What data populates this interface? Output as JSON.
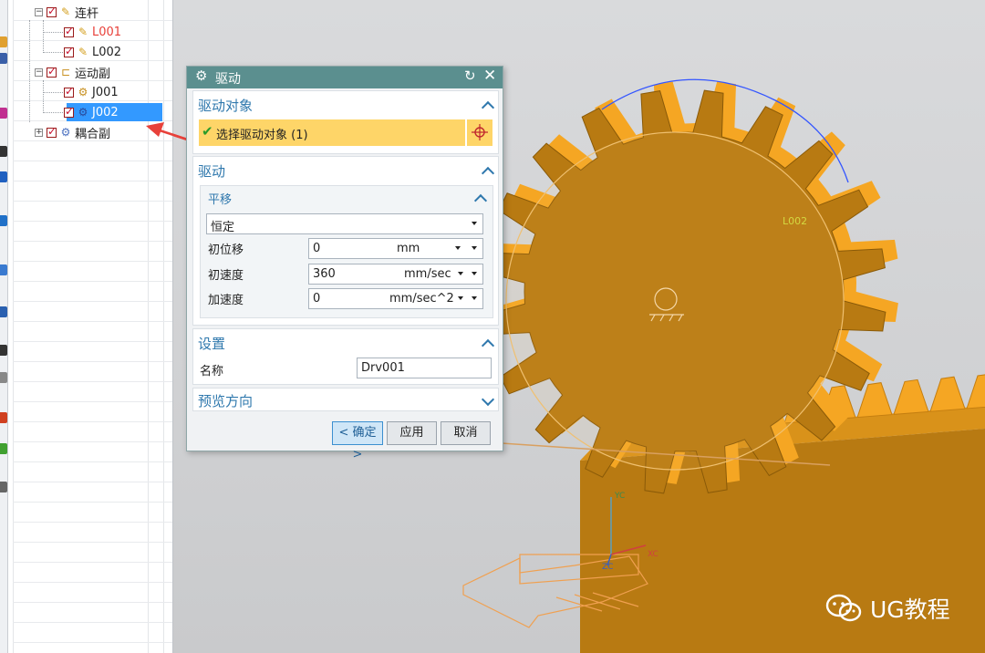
{
  "tree": {
    "rows": [
      {
        "label": "连杆",
        "icon": "link-group-icon",
        "expander": "−",
        "color": "#222"
      },
      {
        "label": "L001",
        "icon": "link-icon",
        "expander": "",
        "color": "#e8413a"
      },
      {
        "label": "L002",
        "icon": "link-icon",
        "expander": "",
        "color": "#222"
      },
      {
        "label": "运动副",
        "icon": "joint-group-icon",
        "expander": "−",
        "color": "#222"
      },
      {
        "label": "J001",
        "icon": "joint-icon",
        "expander": "",
        "color": "#222"
      },
      {
        "label": "J002",
        "icon": "joint-selected-icon",
        "expander": "",
        "color": "#ffffff"
      },
      {
        "label": "耦合副",
        "icon": "coupler-icon",
        "expander": "+",
        "color": "#222"
      }
    ]
  },
  "dialog": {
    "title": "驱动",
    "sections": {
      "drive_object": {
        "header": "驱动对象",
        "select_label": "选择驱动对象 (1)"
      },
      "drive": {
        "header": "驱动",
        "translation": {
          "header": "平移",
          "mode": "恒定",
          "rows": [
            {
              "label": "初位移",
              "value": "0",
              "unit": "mm"
            },
            {
              "label": "初速度",
              "value": "360",
              "unit": "mm/sec"
            },
            {
              "label": "加速度",
              "value": "0",
              "unit": "mm/sec^2"
            }
          ]
        }
      },
      "settings": {
        "header": "设置",
        "name_label": "名称",
        "name_value": "Drv001"
      },
      "preview": {
        "header": "预览方向"
      }
    },
    "buttons": {
      "ok": "< 确定 >",
      "apply": "应用",
      "cancel": "取消"
    }
  },
  "viewport": {
    "link_label": "L002",
    "axis_labels": {
      "y": "YC",
      "x": "XC",
      "z": "ZC"
    }
  },
  "watermark": {
    "text": "UG教程"
  },
  "colors": {
    "titlebar": "#5b8f8f",
    "section_header": "#2f78ad",
    "selection_highlight": "#fed568",
    "tree_selected": "#3399ff",
    "gear_face": "#b87a12",
    "gear_teeth": "#f5a623",
    "annotation_arrow": "#e8413a"
  }
}
